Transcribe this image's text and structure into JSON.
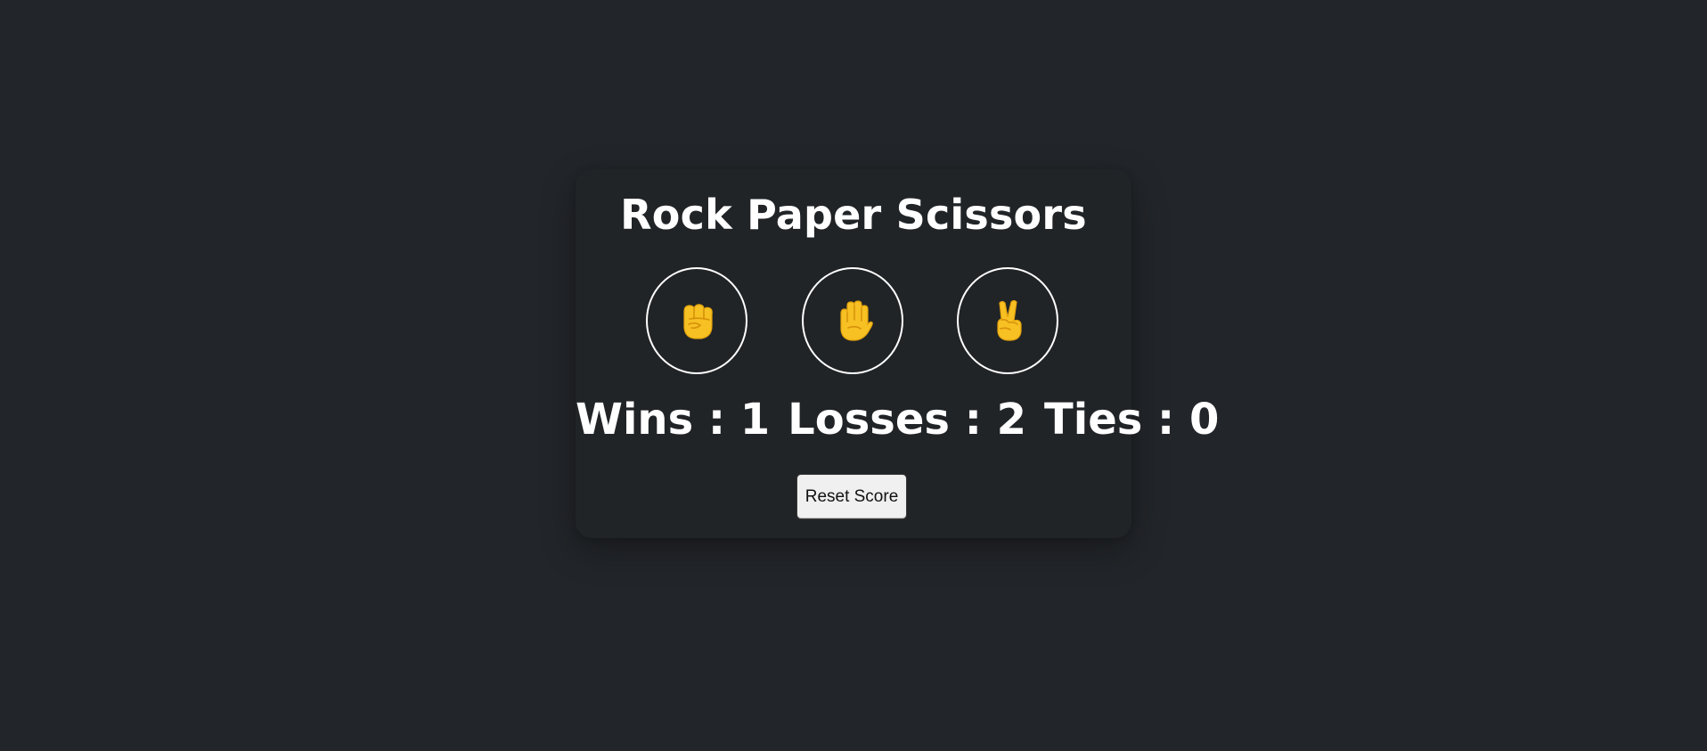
{
  "game": {
    "title": "Rock Paper Scissors",
    "choices": [
      {
        "id": "rock",
        "icon": "raised-fist-icon",
        "color": "#F7C023"
      },
      {
        "id": "paper",
        "icon": "raised-hand-icon",
        "color": "#F7C023"
      },
      {
        "id": "scissors",
        "icon": "victory-hand-icon",
        "color": "#F7C023"
      }
    ],
    "score": {
      "wins_text": "Wins : 1",
      "losses_text": "Losses : 2",
      "ties_text": "Ties : 0"
    },
    "reset_label": "Reset Score"
  },
  "colors": {
    "background": "#222529",
    "card": "#212427",
    "text": "#ffffff",
    "button_bg": "#f0f0f0",
    "emoji": "#F7C023"
  }
}
